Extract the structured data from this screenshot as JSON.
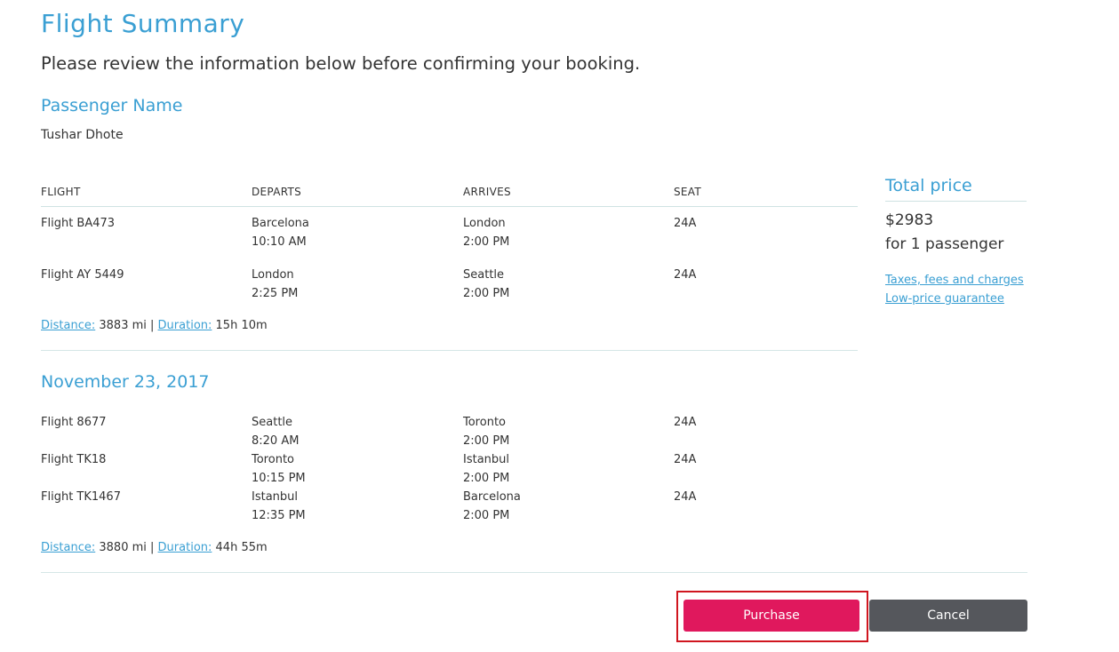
{
  "page": {
    "title": "Flight Summary",
    "intro": "Please review the information below before confirming your booking."
  },
  "passenger": {
    "heading": "Passenger Name",
    "name": "Tushar Dhote"
  },
  "table_headers": [
    "FLIGHT",
    "DEPARTS",
    "ARRIVES",
    "SEAT"
  ],
  "outbound": {
    "legs": [
      {
        "flight": "Flight BA473",
        "from": "Barcelona",
        "dep_time": "10:10 AM",
        "to": "London",
        "arr_time": "2:00 PM",
        "seat": "24A"
      },
      {
        "flight": "Flight AY 5449",
        "from": "London",
        "dep_time": "2:25 PM",
        "to": "Seattle",
        "arr_time": "2:00 PM",
        "seat": "24A"
      }
    ],
    "distance_label": "Distance:",
    "distance": "3883 mi",
    "separator": "|",
    "duration_label": "Duration:",
    "duration": "15h 10m"
  },
  "return": {
    "date": "November 23, 2017",
    "legs": [
      {
        "flight": "Flight 8677",
        "from": "Seattle",
        "dep_time": "8:20 AM",
        "to": "Toronto",
        "arr_time": "2:00 PM",
        "seat": "24A"
      },
      {
        "flight": "Flight TK18",
        "from": "Toronto",
        "dep_time": "10:15 PM",
        "to": "Istanbul",
        "arr_time": "2:00 PM",
        "seat": "24A"
      },
      {
        "flight": "Flight TK1467",
        "from": "Istanbul",
        "dep_time": "12:35 PM",
        "to": "Barcelona",
        "arr_time": "2:00 PM",
        "seat": "24A"
      }
    ],
    "distance_label": "Distance:",
    "distance": "3880 mi",
    "separator": "|",
    "duration_label": "Duration:",
    "duration": "44h 55m"
  },
  "price": {
    "title": "Total price",
    "amount": "$2983",
    "passengers": "for 1 passenger",
    "links": [
      "Taxes, fees and charges",
      "Low-price guarantee"
    ]
  },
  "actions": {
    "purchase": "Purchase",
    "cancel": "Cancel"
  },
  "colors": {
    "accent": "#3a9fd3",
    "purchase_button": "#e0185d",
    "cancel_button": "#55575c",
    "highlight": "#d0161f"
  }
}
